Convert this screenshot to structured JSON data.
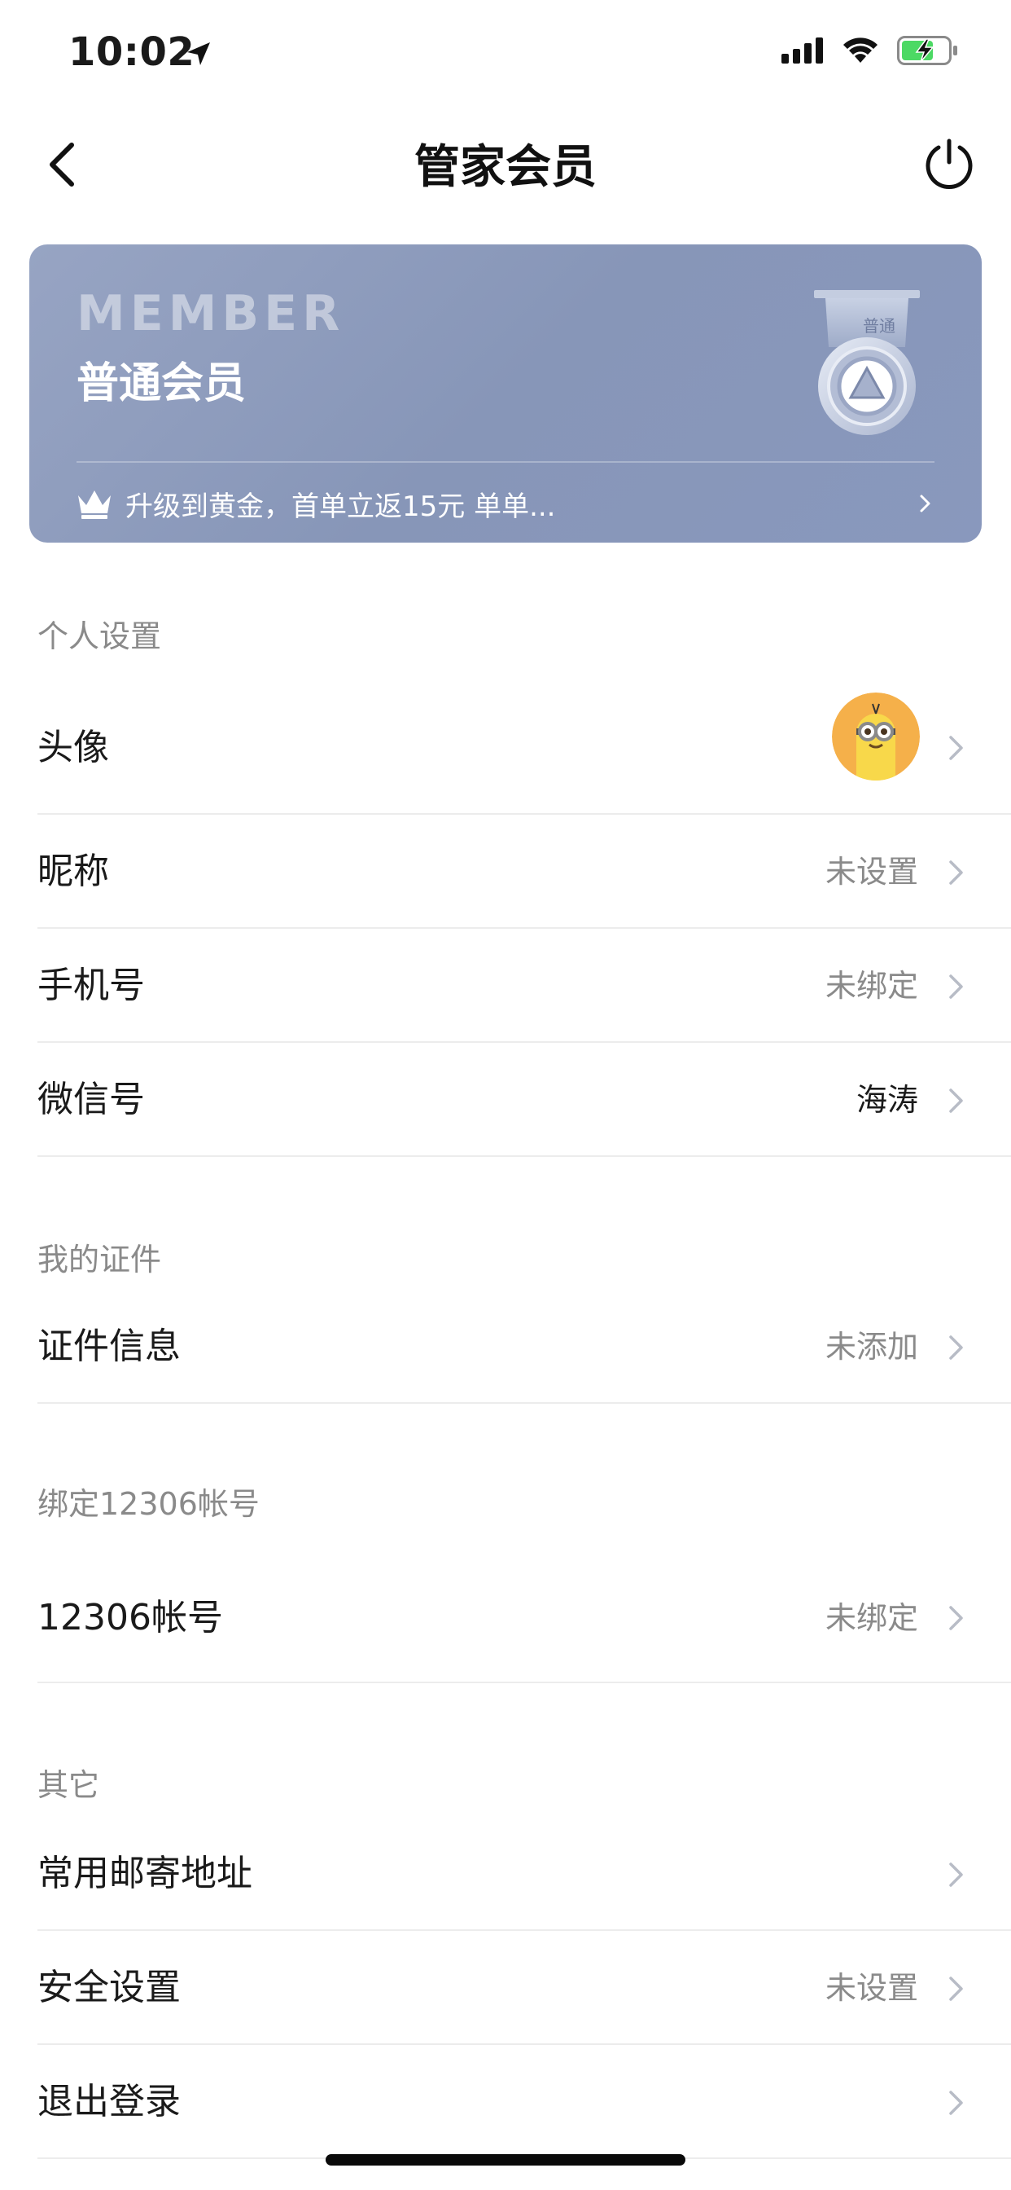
{
  "status": {
    "time": "10:02",
    "battery_color": "#4cd964"
  },
  "nav": {
    "title": "管家会员",
    "back_icon": "chevron-left-icon",
    "power_icon": "power-icon"
  },
  "member_card": {
    "title_en": "MEMBER",
    "level": "普通会员",
    "badge_label": "普通",
    "promo": "升级到黄金，首单立返15元 单单...",
    "gradient_color": "#8796b8"
  },
  "sections": {
    "personal": {
      "header": "个人设置",
      "rows": [
        {
          "label": "头像",
          "value": ""
        },
        {
          "label": "昵称",
          "value": "未设置"
        },
        {
          "label": "手机号",
          "value": "未绑定"
        },
        {
          "label": "微信号",
          "value": "海涛"
        }
      ]
    },
    "certificate": {
      "header": "我的证件",
      "rows": [
        {
          "label": "证件信息",
          "value": "未添加"
        }
      ]
    },
    "account_12306": {
      "header": "绑定12306帐号",
      "rows": [
        {
          "label": "12306帐号",
          "value": "未绑定"
        }
      ]
    },
    "other": {
      "header": "其它",
      "rows": [
        {
          "label": "常用邮寄地址",
          "value": ""
        },
        {
          "label": "安全设置",
          "value": "未设置"
        },
        {
          "label": "退出登录",
          "value": ""
        }
      ]
    }
  }
}
